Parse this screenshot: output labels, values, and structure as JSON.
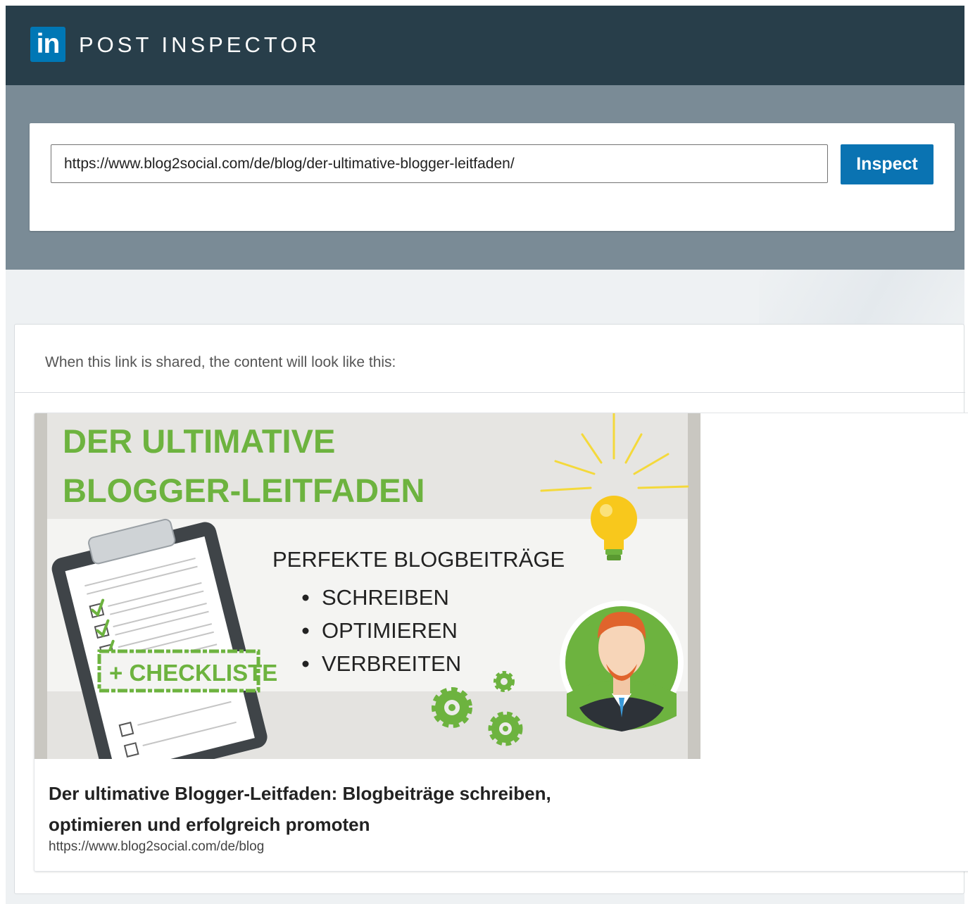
{
  "app": {
    "logo_text": "in",
    "title": "POST INSPECTOR"
  },
  "search": {
    "url_value": "https://www.blog2social.com/de/blog/der-ultimative-blogger-leitfaden/",
    "inspect_label": "Inspect"
  },
  "result": {
    "hint": "When this link is shared, the content will look like this:",
    "image_text": {
      "headline_line1": "DER ULTIMATIVE",
      "headline_line2": "BLOGGER-LEITFADEN",
      "subheadline": "PERFEKTE BLOGBEITRÄGE",
      "bullets": [
        "SCHREIBEN",
        "OPTIMIEREN",
        "VERBREITEN"
      ],
      "stamp": "+ CHECKLISTE"
    },
    "title": "Der ultimative Blogger-Leitfaden: Blogbeiträge schreiben, optimieren und erfolgreich promoten",
    "url": "https://www.blog2social.com/de/blog"
  },
  "colors": {
    "header_bg": "#283e4a",
    "band_bg": "#7a8b96",
    "linkedin_blue": "#0077b5",
    "button_blue": "#0a73b2",
    "image_green": "#6db33f"
  },
  "icons": [
    "linkedin-logo-icon",
    "clipboard-icon",
    "lightbulb-icon",
    "gear-icon",
    "avatar-icon"
  ]
}
